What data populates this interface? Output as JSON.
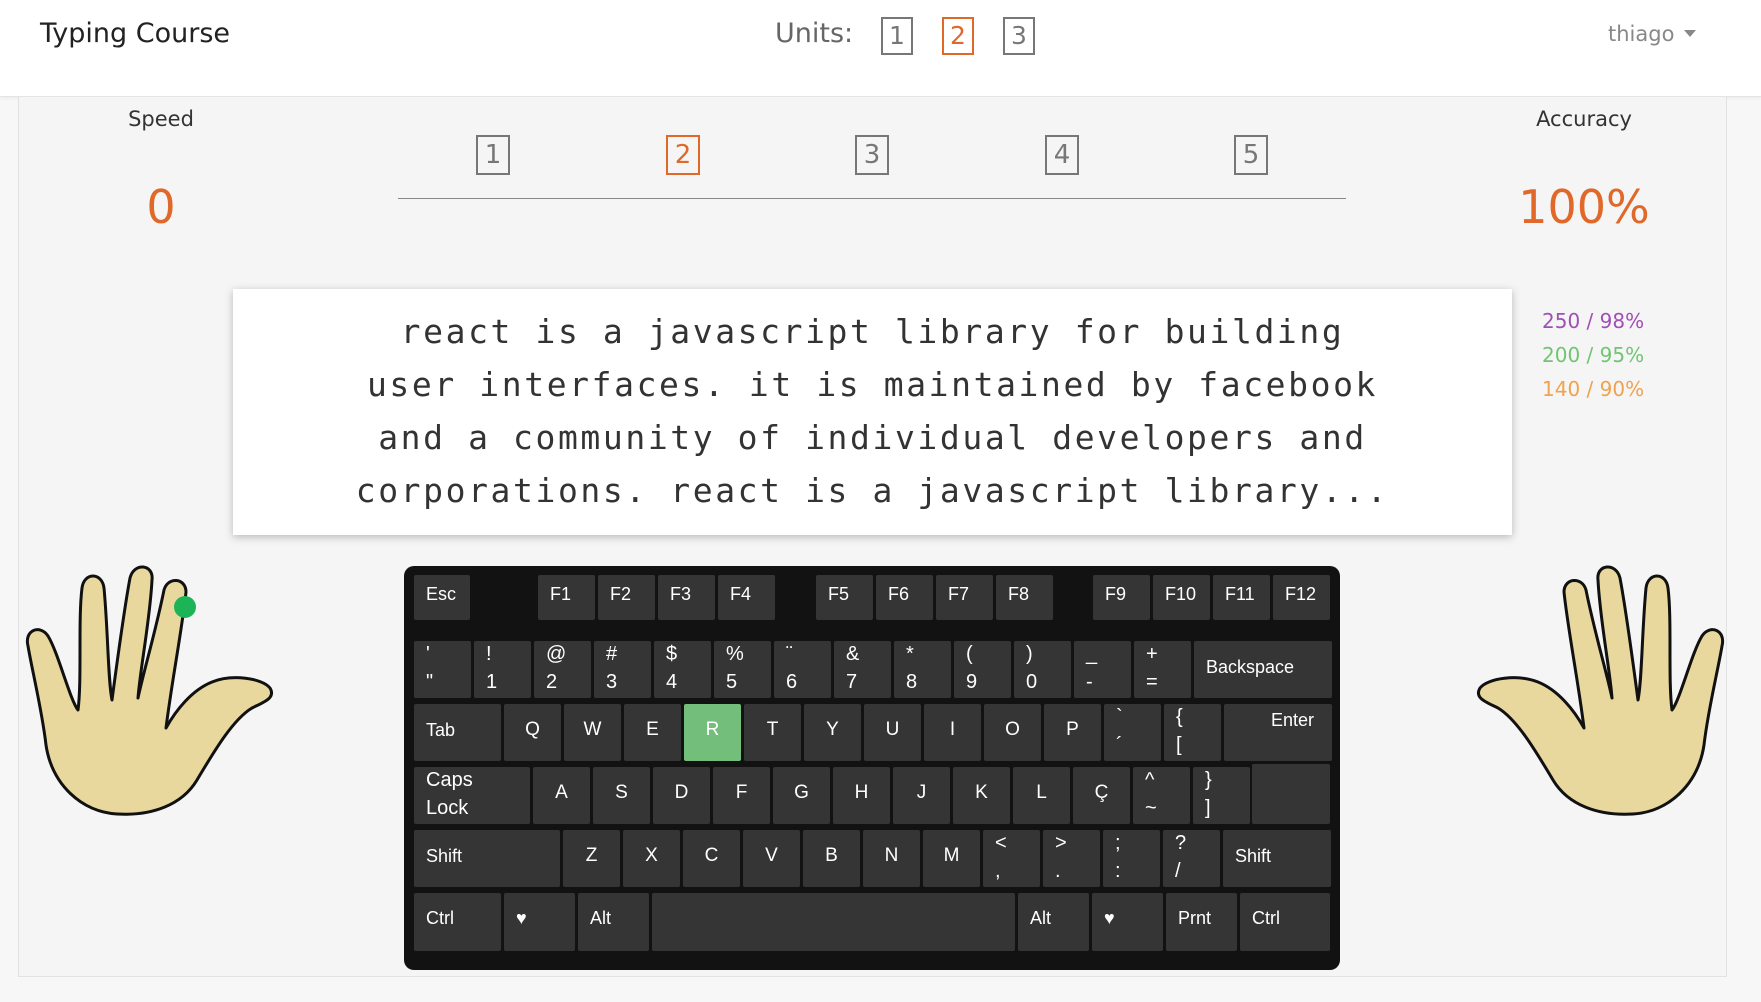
{
  "header": {
    "brand": "Typing Course",
    "units_label": "Units:",
    "units": [
      "1",
      "2",
      "3"
    ],
    "active_unit": "2",
    "user": "thiago"
  },
  "stats": {
    "speed_label": "Speed",
    "speed_value": "0",
    "accuracy_label": "Accuracy",
    "accuracy_value": "100%"
  },
  "lessons": {
    "items": [
      "1",
      "2",
      "3",
      "4",
      "5"
    ],
    "active": "2"
  },
  "text": {
    "lines": [
      "react is a javascript library for building",
      "user interfaces. it is maintained by facebook",
      "and a community of individual developers and",
      "corporations. react is a javascript library..."
    ]
  },
  "goals": [
    {
      "label": "250 / 98%",
      "color": "#a04fb4"
    },
    {
      "label": "200 / 95%",
      "color": "#72c472"
    },
    {
      "label": "140 / 90%",
      "color": "#f0a24e"
    }
  ],
  "keyboard": {
    "highlighted_key": "R",
    "function_row": [
      "Esc",
      "F1",
      "F2",
      "F3",
      "F4",
      "F5",
      "F6",
      "F7",
      "F8",
      "F9",
      "F10",
      "F11",
      "F12"
    ],
    "number_row": [
      {
        "top": "'",
        "bottom": "\""
      },
      {
        "top": "!",
        "bottom": "1"
      },
      {
        "top": "@",
        "bottom": "2"
      },
      {
        "top": "#",
        "bottom": "3"
      },
      {
        "top": "$",
        "bottom": "4"
      },
      {
        "top": "%",
        "bottom": "5"
      },
      {
        "top": "¨",
        "bottom": "6"
      },
      {
        "top": "&",
        "bottom": "7"
      },
      {
        "top": "*",
        "bottom": "8"
      },
      {
        "top": "(",
        "bottom": "9"
      },
      {
        "top": ")",
        "bottom": "0"
      },
      {
        "top": "_",
        "bottom": "-"
      },
      {
        "top": "+",
        "bottom": "="
      },
      {
        "label": "Backspace"
      }
    ],
    "top_row": [
      {
        "label": "Tab"
      },
      {
        "char": "Q"
      },
      {
        "char": "W"
      },
      {
        "char": "E"
      },
      {
        "char": "R"
      },
      {
        "char": "T"
      },
      {
        "char": "Y"
      },
      {
        "char": "U"
      },
      {
        "char": "I"
      },
      {
        "char": "O"
      },
      {
        "char": "P"
      },
      {
        "top": "`",
        "bottom": "´"
      },
      {
        "top": "{",
        "bottom": "["
      },
      {
        "label": "Enter"
      }
    ],
    "home_row": [
      {
        "top": "Caps",
        "bottom": "Lock"
      },
      {
        "char": "A"
      },
      {
        "char": "S"
      },
      {
        "char": "D"
      },
      {
        "char": "F"
      },
      {
        "char": "G"
      },
      {
        "char": "H"
      },
      {
        "char": "J"
      },
      {
        "char": "K"
      },
      {
        "char": "L"
      },
      {
        "char": "Ç"
      },
      {
        "top": "^",
        "bottom": "~"
      },
      {
        "top": "}",
        "bottom": "]"
      }
    ],
    "shift_row": [
      {
        "label": "Shift"
      },
      {
        "char": "Z"
      },
      {
        "char": "X"
      },
      {
        "char": "C"
      },
      {
        "char": "V"
      },
      {
        "char": "B"
      },
      {
        "char": "N"
      },
      {
        "char": "M"
      },
      {
        "top": "<",
        "bottom": ","
      },
      {
        "top": ">",
        "bottom": "."
      },
      {
        "top": ";",
        "bottom": ":"
      },
      {
        "top": "?",
        "bottom": "/"
      },
      {
        "label": "Shift"
      }
    ],
    "bottom_row": [
      "Ctrl",
      "♥",
      "Alt",
      "",
      "Alt",
      "♥",
      "Prnt",
      "Ctrl"
    ]
  },
  "hands": {
    "active_finger": "left-index",
    "indicator_color": "#1db357"
  }
}
